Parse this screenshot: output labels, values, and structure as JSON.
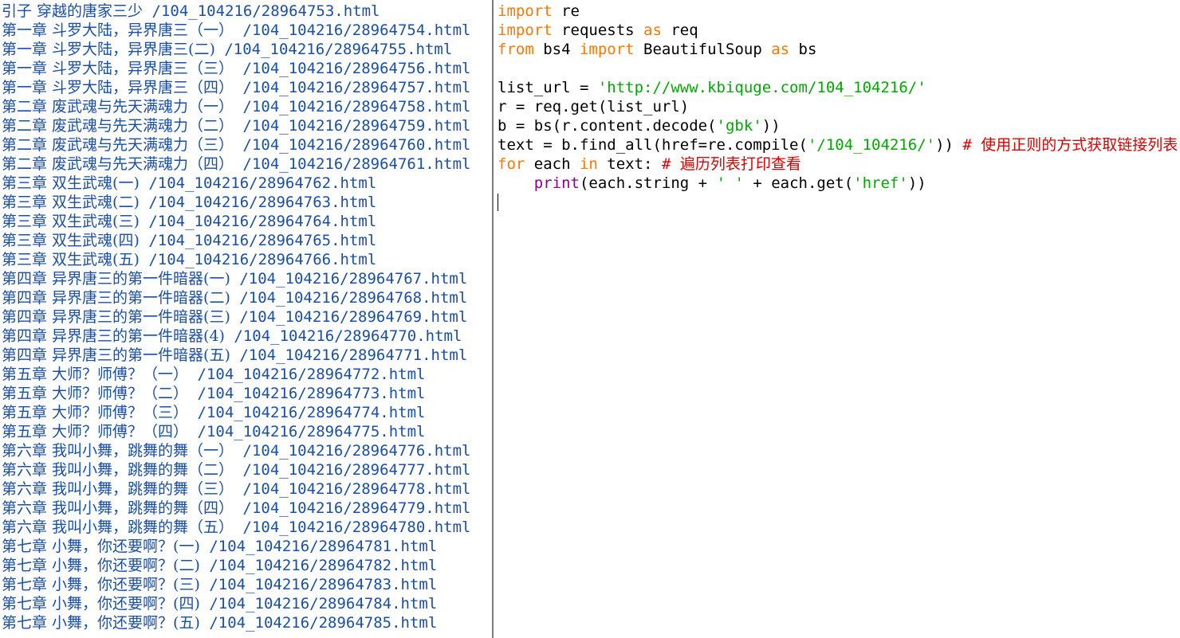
{
  "output": {
    "lines": [
      {
        "title": "引子 穿越的唐家三少",
        "path": "/104_104216/28964753.html"
      },
      {
        "title": "第一章 斗罗大陆，异界唐三（一）",
        "path": "/104_104216/28964754.html"
      },
      {
        "title": "第一章 斗罗大陆，异界唐三(二)",
        "path": "/104_104216/28964755.html"
      },
      {
        "title": "第一章 斗罗大陆，异界唐三（三）",
        "path": "/104_104216/28964756.html"
      },
      {
        "title": "第一章 斗罗大陆，异界唐三（四）",
        "path": "/104_104216/28964757.html"
      },
      {
        "title": "第二章 废武魂与先天满魂力（一）",
        "path": "/104_104216/28964758.html"
      },
      {
        "title": "第二章 废武魂与先天满魂力（二）",
        "path": "/104_104216/28964759.html"
      },
      {
        "title": "第二章 废武魂与先天满魂力（三）",
        "path": "/104_104216/28964760.html"
      },
      {
        "title": "第二章 废武魂与先天满魂力（四）",
        "path": "/104_104216/28964761.html"
      },
      {
        "title": "第三章 双生武魂(一)",
        "path": "/104_104216/28964762.html"
      },
      {
        "title": "第三章 双生武魂(二)",
        "path": "/104_104216/28964763.html"
      },
      {
        "title": "第三章 双生武魂(三)",
        "path": "/104_104216/28964764.html"
      },
      {
        "title": "第三章 双生武魂(四)",
        "path": "/104_104216/28964765.html"
      },
      {
        "title": "第三章 双生武魂(五)",
        "path": "/104_104216/28964766.html"
      },
      {
        "title": "第四章 异界唐三的第一件暗器(一)",
        "path": "/104_104216/28964767.html"
      },
      {
        "title": "第四章 异界唐三的第一件暗器(二)",
        "path": "/104_104216/28964768.html"
      },
      {
        "title": "第四章 异界唐三的第一件暗器(三)",
        "path": "/104_104216/28964769.html"
      },
      {
        "title": "第四章 异界唐三的第一件暗器(4)",
        "path": "/104_104216/28964770.html"
      },
      {
        "title": "第四章 异界唐三的第一件暗器(五)",
        "path": "/104_104216/28964771.html"
      },
      {
        "title": "第五章 大师？师傅？（一）",
        "path": "/104_104216/28964772.html"
      },
      {
        "title": "第五章 大师？师傅？（二）",
        "path": "/104_104216/28964773.html"
      },
      {
        "title": "第五章 大师？师傅？（三）",
        "path": "/104_104216/28964774.html"
      },
      {
        "title": "第五章 大师？师傅？（四）",
        "path": "/104_104216/28964775.html"
      },
      {
        "title": "第六章 我叫小舞，跳舞的舞（一）",
        "path": "/104_104216/28964776.html"
      },
      {
        "title": "第六章 我叫小舞，跳舞的舞（二）",
        "path": "/104_104216/28964777.html"
      },
      {
        "title": "第六章 我叫小舞，跳舞的舞（三）",
        "path": "/104_104216/28964778.html"
      },
      {
        "title": "第六章 我叫小舞，跳舞的舞（四）",
        "path": "/104_104216/28964779.html"
      },
      {
        "title": "第六章 我叫小舞，跳舞的舞（五）",
        "path": "/104_104216/28964780.html"
      },
      {
        "title": "第七章 小舞，你还要啊？(一)",
        "path": "/104_104216/28964781.html"
      },
      {
        "title": "第七章 小舞，你还要啊？(二)",
        "path": "/104_104216/28964782.html"
      },
      {
        "title": "第七章 小舞，你还要啊？(三)",
        "path": "/104_104216/28964783.html"
      },
      {
        "title": "第七章 小舞，你还要啊？(四)",
        "path": "/104_104216/28964784.html"
      },
      {
        "title": "第七章 小舞，你还要啊？(五)",
        "path": "/104_104216/28964785.html"
      }
    ]
  },
  "editor": {
    "l1": {
      "kw": "import",
      "rest": " re"
    },
    "l2": {
      "kw": "import",
      "mid": " requests ",
      "kw2": "as",
      "rest": " req"
    },
    "l3": {
      "kw": "from",
      "mid": " bs4 ",
      "kw2": "import",
      "mid2": " BeautifulSoup ",
      "kw3": "as",
      "rest": " bs"
    },
    "l5": {
      "pre": "list_url = ",
      "str": "'http://www.kbiquge.com/104_104216/'"
    },
    "l6": {
      "text": "r = req.get(list_url)"
    },
    "l7": {
      "pre": "b = bs(r.content.decode(",
      "str": "'gbk'",
      "post": "))"
    },
    "l8": {
      "pre": "text = b.find_all(href=re.compile(",
      "str": "'/104_104216/'",
      "post": ")) ",
      "comment": "# 使用正则的方式获取链接列表"
    },
    "l9": {
      "kw": "for",
      "mid": " each ",
      "kw2": "in",
      "post": " text: ",
      "comment": "# 遍历列表打印查看"
    },
    "l10": {
      "indent": "    ",
      "builtin": "print",
      "pre": "(each.string + ",
      "str": "' '",
      "mid": " + each.get(",
      "str2": "'href'",
      "post": "))"
    }
  }
}
